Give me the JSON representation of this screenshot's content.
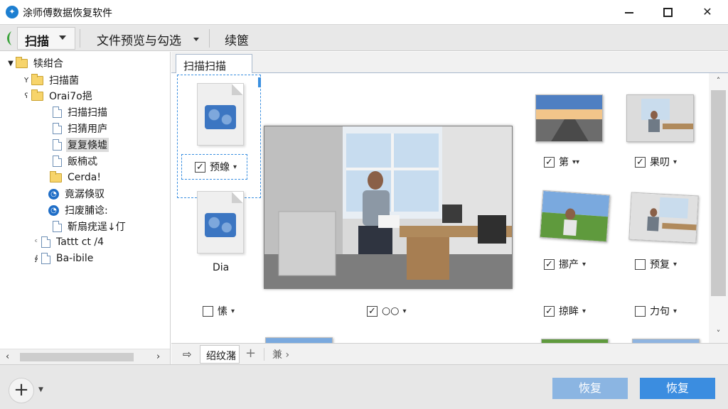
{
  "window": {
    "title": "涂师傅数据恢复软件",
    "app_icon": "app-logo-icon",
    "controls": [
      "minimize-icon",
      "maximize-icon",
      "close-icon"
    ]
  },
  "toolbar": {
    "scan_label": "扫描",
    "preview_label": "文件预览与勾选",
    "continue_label": "续篋"
  },
  "tree": {
    "items": [
      {
        "label": "犊绀合",
        "icon": "folder-icon"
      },
      {
        "label": "扫描菌",
        "icon": "folder-icon"
      },
      {
        "label": "Orai7o挹",
        "icon": "folder-icon"
      },
      {
        "label": "扫描扫描",
        "icon": "file-icon"
      },
      {
        "label": "扫猜用庐",
        "icon": "file-icon"
      },
      {
        "label": "复复倏墟",
        "icon": "file-icon"
      },
      {
        "label": "飯楠忒",
        "icon": "file-icon"
      },
      {
        "label": "Cerda!",
        "icon": "folder-icon"
      },
      {
        "label": "竟潺倏驭",
        "icon": "globe-icon"
      },
      {
        "label": "扫废脯谂:",
        "icon": "globe-icon"
      },
      {
        "label": "靳扇疣逞↓仃",
        "icon": "file-icon"
      },
      {
        "label": "Tattt ct /4",
        "icon": "file-icon"
      },
      {
        "label": "Ba-ibile",
        "icon": "file-icon"
      }
    ]
  },
  "tabs": {
    "active_label": "扫描扫描"
  },
  "files": {
    "doc1_check_label": "预蟓",
    "doc2_label": "Dia",
    "row_bottom": [
      {
        "label": "愫",
        "checked": false
      },
      {
        "label": "○○",
        "checked": true
      }
    ],
    "right_items": [
      {
        "label": "第",
        "checked": true
      },
      {
        "label": "果叨",
        "checked": true
      },
      {
        "label": "挪产",
        "checked": true
      },
      {
        "label": "预复",
        "checked": false
      },
      {
        "label": "掠眸",
        "checked": true
      },
      {
        "label": "力句",
        "checked": false
      }
    ]
  },
  "bottom_tabs": {
    "tab_label": "绍纹潴",
    "more_label": "兼 ›"
  },
  "footer": {
    "restore_label_1": "恢复",
    "restore_label_2": "恢复"
  }
}
